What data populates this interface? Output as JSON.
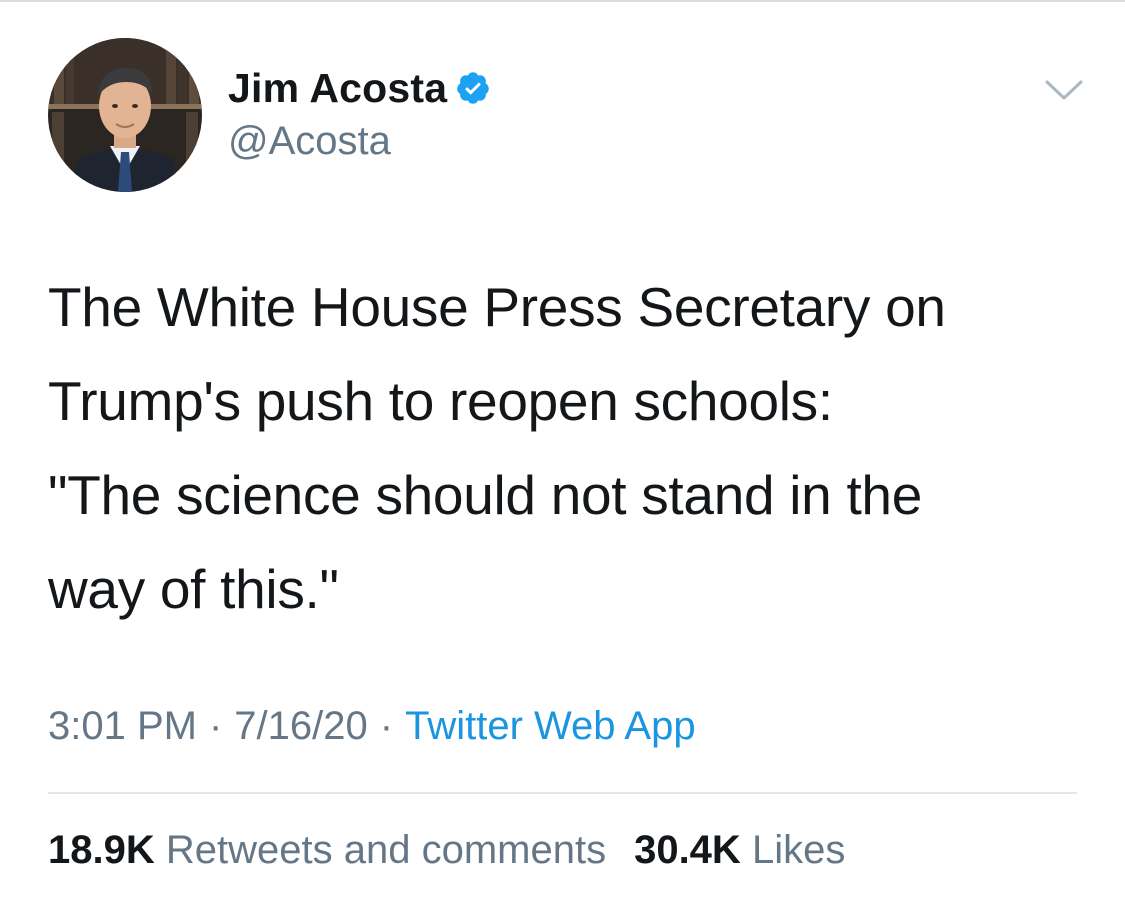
{
  "author": {
    "display_name": "Jim Acosta",
    "handle": "@Acosta",
    "verified": true
  },
  "tweet": {
    "text_lines": [
      "The White House Press Secretary on",
      "Trump's push to reopen schools:",
      "\"The science should not stand in the",
      "way of this.\""
    ],
    "time": "3:01 PM",
    "date": "7/16/20",
    "separator": "·",
    "source": "Twitter Web App"
  },
  "stats": {
    "retweets_count": "18.9K",
    "retweets_label": "Retweets and comments",
    "likes_count": "30.4K",
    "likes_label": "Likes"
  },
  "icons": {
    "verified_badge": "verified-badge-icon",
    "more_menu": "chevron-down-icon"
  },
  "colors": {
    "text_primary": "#14171a",
    "text_secondary": "#657786",
    "link": "#1b95e0",
    "verified": "#1da1f2",
    "divider": "#e1e8ed"
  }
}
